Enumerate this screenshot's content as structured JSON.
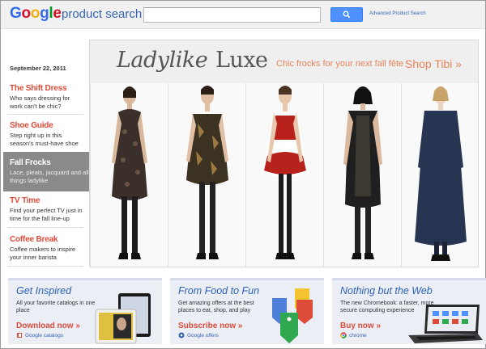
{
  "header": {
    "logo_letters": [
      "G",
      "o",
      "o",
      "g",
      "l",
      "e"
    ],
    "logo_colors": [
      "#3369e8",
      "#d50f25",
      "#eeb211",
      "#3369e8",
      "#009925",
      "#d50f25"
    ],
    "logo_suffix": "product search",
    "search_placeholder": "",
    "search_icon": "search-icon",
    "advanced_link": "Advanced Product Search"
  },
  "sidebar": {
    "date": "September 22, 2011",
    "items": [
      {
        "title": "The Shift Dress",
        "desc": "Who says dressing for work can't be chic?",
        "active": false
      },
      {
        "title": "Shoe Guide",
        "desc": "Step right up in this season's must-have shoe",
        "active": false
      },
      {
        "title": "Fall Frocks",
        "desc": "Lace, pleats, jacquard and all things ladylike",
        "active": true
      },
      {
        "title": "TV Time",
        "desc": "Find your perfect TV just in time for the fall line-up",
        "active": false
      },
      {
        "title": "Coffee Break",
        "desc": "Coffee makers to inspire your inner barista",
        "active": false
      }
    ]
  },
  "hero": {
    "title_italic": "Ladylike",
    "title_plain": "Luxe",
    "tagline": "Chic frocks for your next fall fête",
    "link": "Shop Tibi »",
    "link_color": "#e8835a",
    "models": [
      {
        "dress": "dark patterned print dress",
        "color": "#3a2f2a"
      },
      {
        "dress": "black and gold print dress",
        "color": "#3b3222"
      },
      {
        "dress": "red and white print dress",
        "color": "#b8221c"
      },
      {
        "dress": "dark metallic dress",
        "color": "#1f1f1f"
      },
      {
        "dress": "navy lace dress",
        "color": "#283552"
      }
    ]
  },
  "promos": [
    {
      "title": "Get Inspired",
      "desc": "All your favorite catalogs in one place",
      "cta": "Download now »",
      "brand": "Google catalogs",
      "image": "tablet-catalog-image"
    },
    {
      "title": "From Food to Fun",
      "desc": "Get amazing offers at the best places to eat, shop, and play",
      "cta": "Subscribe now »",
      "brand": "Google offers",
      "image": "offers-tags-image"
    },
    {
      "title": "Nothing but the Web",
      "desc": "The new Chromebook: a faster, more secure computing experience",
      "cta": "Buy now »",
      "brand": "chrome",
      "image": "chromebook-image"
    }
  ],
  "colors": {
    "accent_red": "#dd4b39",
    "link_blue": "#3764b4",
    "promo_blue": "#2a62b8",
    "search_button": "#4d90fe"
  }
}
